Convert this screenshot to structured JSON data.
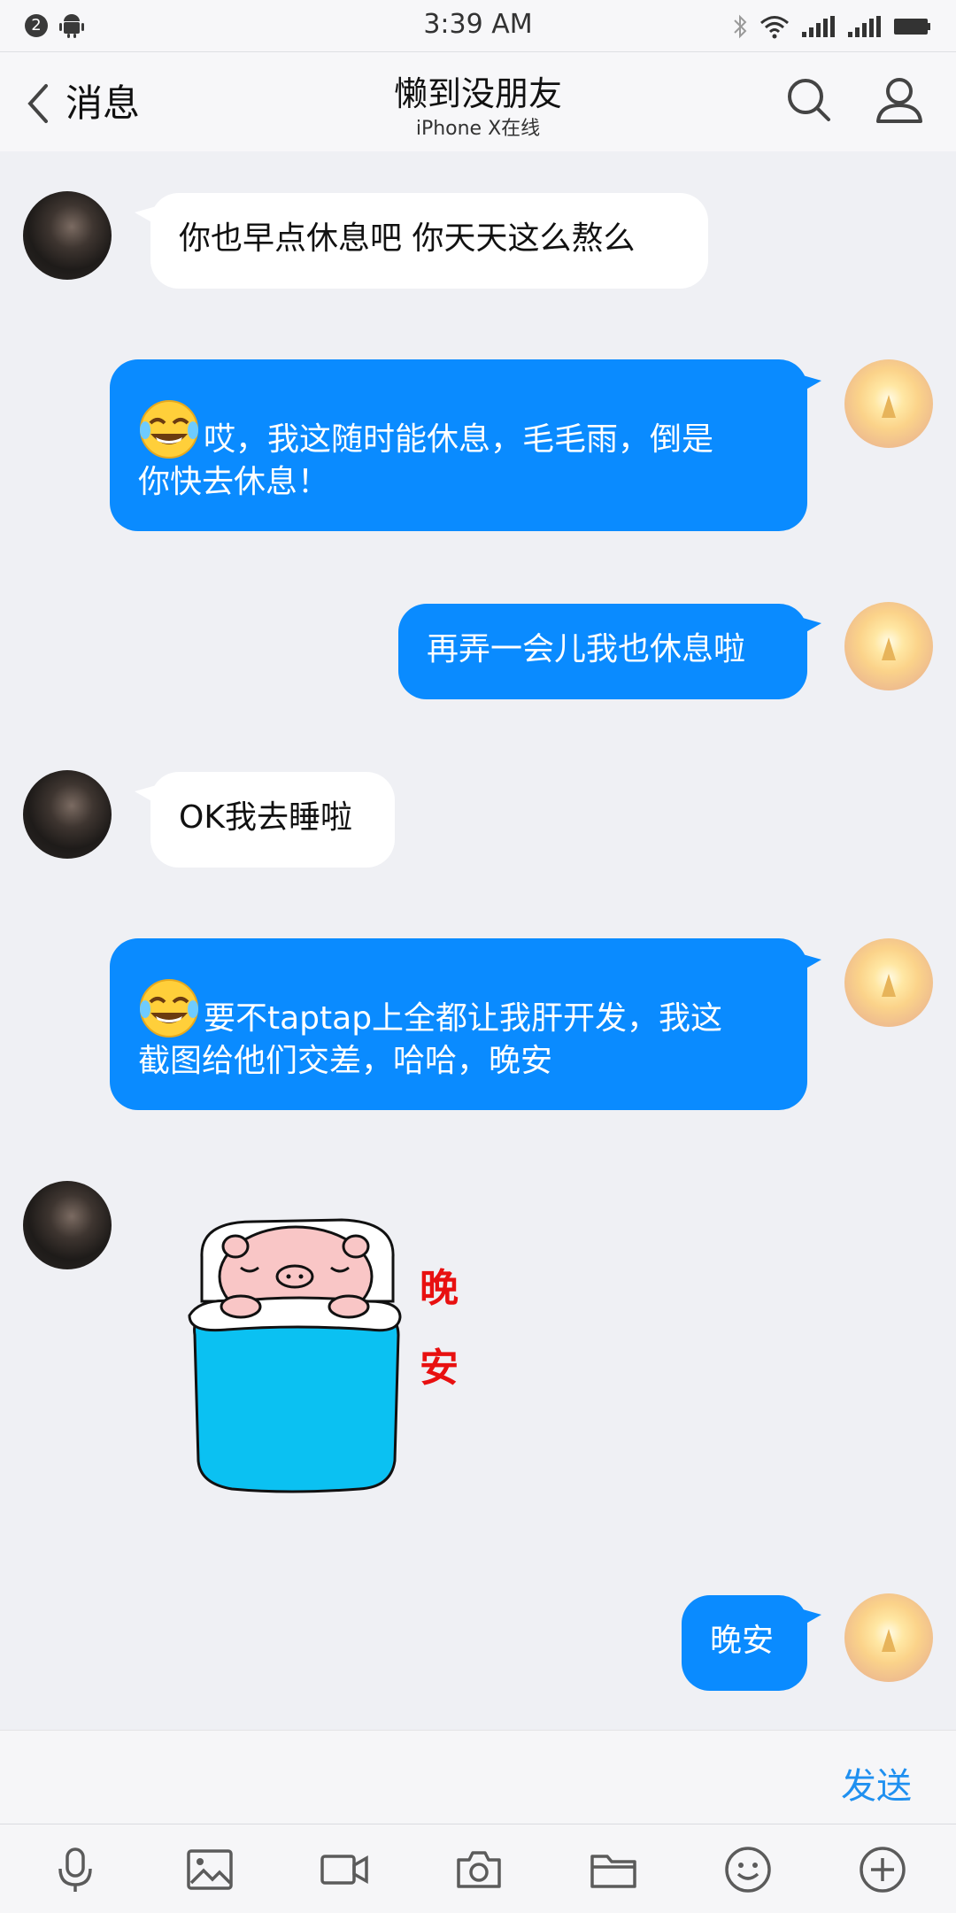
{
  "status_bar": {
    "notification_count": "2",
    "time": "3:39 AM"
  },
  "header": {
    "back_label": "消息",
    "title": "懒到没朋友",
    "subtitle": "iPhone X在线"
  },
  "messages": [
    {
      "side": "left",
      "text": "你也早点休息吧 你天天这么熬么"
    },
    {
      "side": "right",
      "emoji": "tears-of-joy-emoji",
      "line1": "哎，我这随时能休息，毛毛雨，倒是",
      "line2": "你快去休息！"
    },
    {
      "side": "right",
      "text": "再弄一会儿我也休息啦"
    },
    {
      "side": "left",
      "text": "OK我去睡啦"
    },
    {
      "side": "right",
      "emoji": "tears-of-joy-emoji",
      "line1": "要不taptap上全都让我肝开发，我这",
      "line2": "截图给他们交差，哈哈，晚安"
    },
    {
      "side": "left",
      "sticker": "sleeping-pig-sticker",
      "sticker_text": "晚安"
    },
    {
      "side": "right",
      "text": "晚安"
    }
  ],
  "input": {
    "send_label": "发送"
  },
  "toolbar": {
    "items": [
      "microphone-icon",
      "image-icon",
      "video-icon",
      "camera-icon",
      "folder-icon",
      "emoji-icon",
      "plus-icon"
    ]
  },
  "colors": {
    "accent": "#0a8bff",
    "background": "#eff0f4",
    "send": "#1f90f0"
  }
}
